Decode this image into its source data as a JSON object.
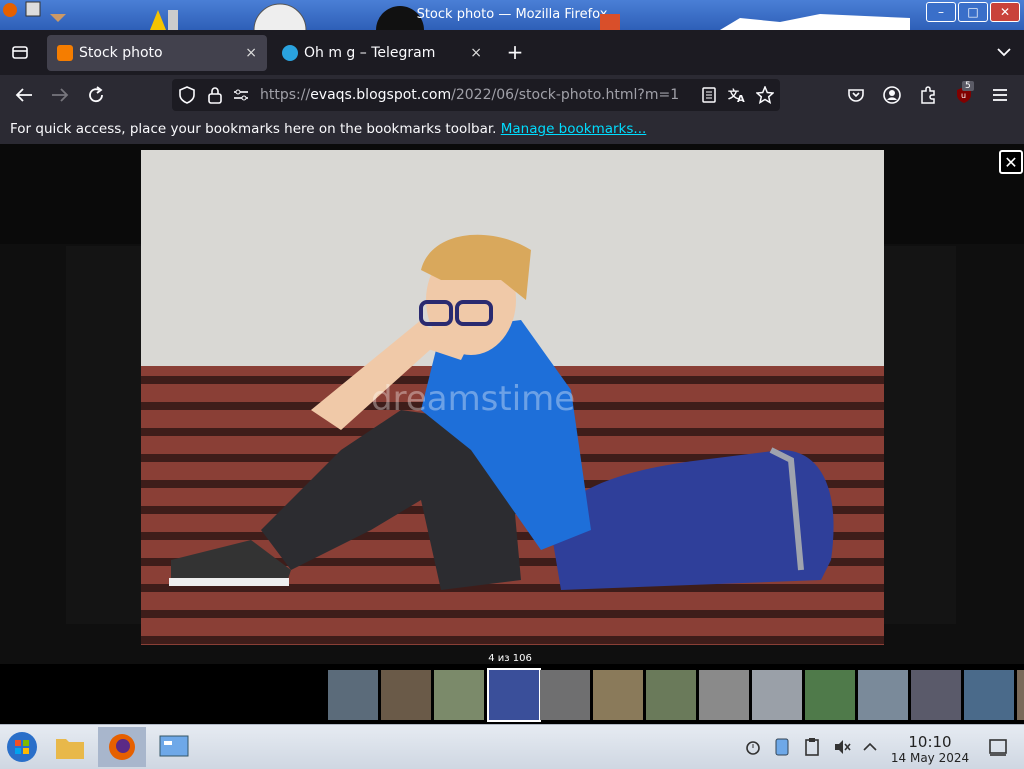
{
  "window": {
    "title": "Stock photo — Mozilla Firefox",
    "controls": {
      "minimize": "–",
      "maximize": "□",
      "close": "✕"
    }
  },
  "tabs": [
    {
      "label": "Stock photo",
      "active": true,
      "favicon": "blogger-favicon",
      "close": "×"
    },
    {
      "label": "Oh m g – Telegram",
      "active": false,
      "favicon": "telegram-favicon",
      "close": "×"
    }
  ],
  "tabstrip": {
    "new_tab": "+",
    "list_all": "⌄"
  },
  "navbar": {
    "url_prefix": "https://",
    "url_host": "evaqs.blogspot.com",
    "url_path": "/2022/06/stock-photo.html?m=1",
    "badge_count": "5"
  },
  "bookmarks_bar": {
    "message": "For quick access, place your bookmarks here on the bookmarks toolbar.",
    "link": "Manage bookmarks..."
  },
  "viewer": {
    "counter": "4 из 106",
    "close": "✕",
    "watermark": "dreamstime",
    "thumbnail_count": 14,
    "active_thumbnail": 4
  },
  "taskbar": {
    "time": "10:10",
    "date": "14 May 2024"
  },
  "colors": {
    "accent_link": "#00ddff",
    "tab_bg": "#1c1b22",
    "toolbar_bg": "#2b2a33"
  }
}
